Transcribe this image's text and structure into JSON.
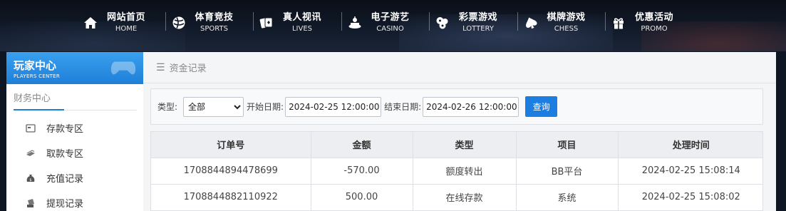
{
  "nav": {
    "items": [
      {
        "cn": "网站首页",
        "en": "HOME",
        "icon": "home-icon"
      },
      {
        "cn": "体育竞技",
        "en": "SPORTS",
        "icon": "ball-icon"
      },
      {
        "cn": "真人视讯",
        "en": "LIVES",
        "icon": "cards-icon"
      },
      {
        "cn": "电子游艺",
        "en": "CASINO",
        "icon": "slot-icon"
      },
      {
        "cn": "彩票游戏",
        "en": "LOTTERY",
        "icon": "lottery-balls-icon"
      },
      {
        "cn": "棋牌游戏",
        "en": "CHESS",
        "icon": "spade-icon"
      },
      {
        "cn": "优惠活动",
        "en": "PROMO",
        "icon": "gift-icon"
      }
    ]
  },
  "sidebar": {
    "title_cn": "玩家中心",
    "title_en": "PLAYERS CENTER",
    "section": "财务中心",
    "items": [
      {
        "label": "存款专区",
        "icon": "deposit-icon"
      },
      {
        "label": "取款专区",
        "icon": "withdraw-icon"
      },
      {
        "label": "充值记录",
        "icon": "money-bag-icon"
      },
      {
        "label": "提现记录",
        "icon": "withdraw-record-icon"
      }
    ]
  },
  "breadcrumb": {
    "label": "资金记录"
  },
  "filter": {
    "type_label": "类型:",
    "type_value": "全部",
    "start_label": "开始日期:",
    "start_value": "2024-02-25 12:00:00",
    "end_label": "结束日期:",
    "end_value": "2024-02-26 12:00:00",
    "search_label": "查询"
  },
  "table": {
    "headers": [
      "订单号",
      "金额",
      "类型",
      "项目",
      "处理时间"
    ],
    "rows": [
      [
        "1708844894478699",
        "-570.00",
        "额度转出",
        "BB平台",
        "2024-02-25 15:08:14"
      ],
      [
        "1708844882110922",
        "500.00",
        "在线存款",
        "系统",
        "2024-02-25 15:08:02"
      ]
    ]
  },
  "colors": {
    "accent": "#1c7ee0",
    "sidebar_header": "#2a8fe6",
    "topbar": "#111a29"
  }
}
